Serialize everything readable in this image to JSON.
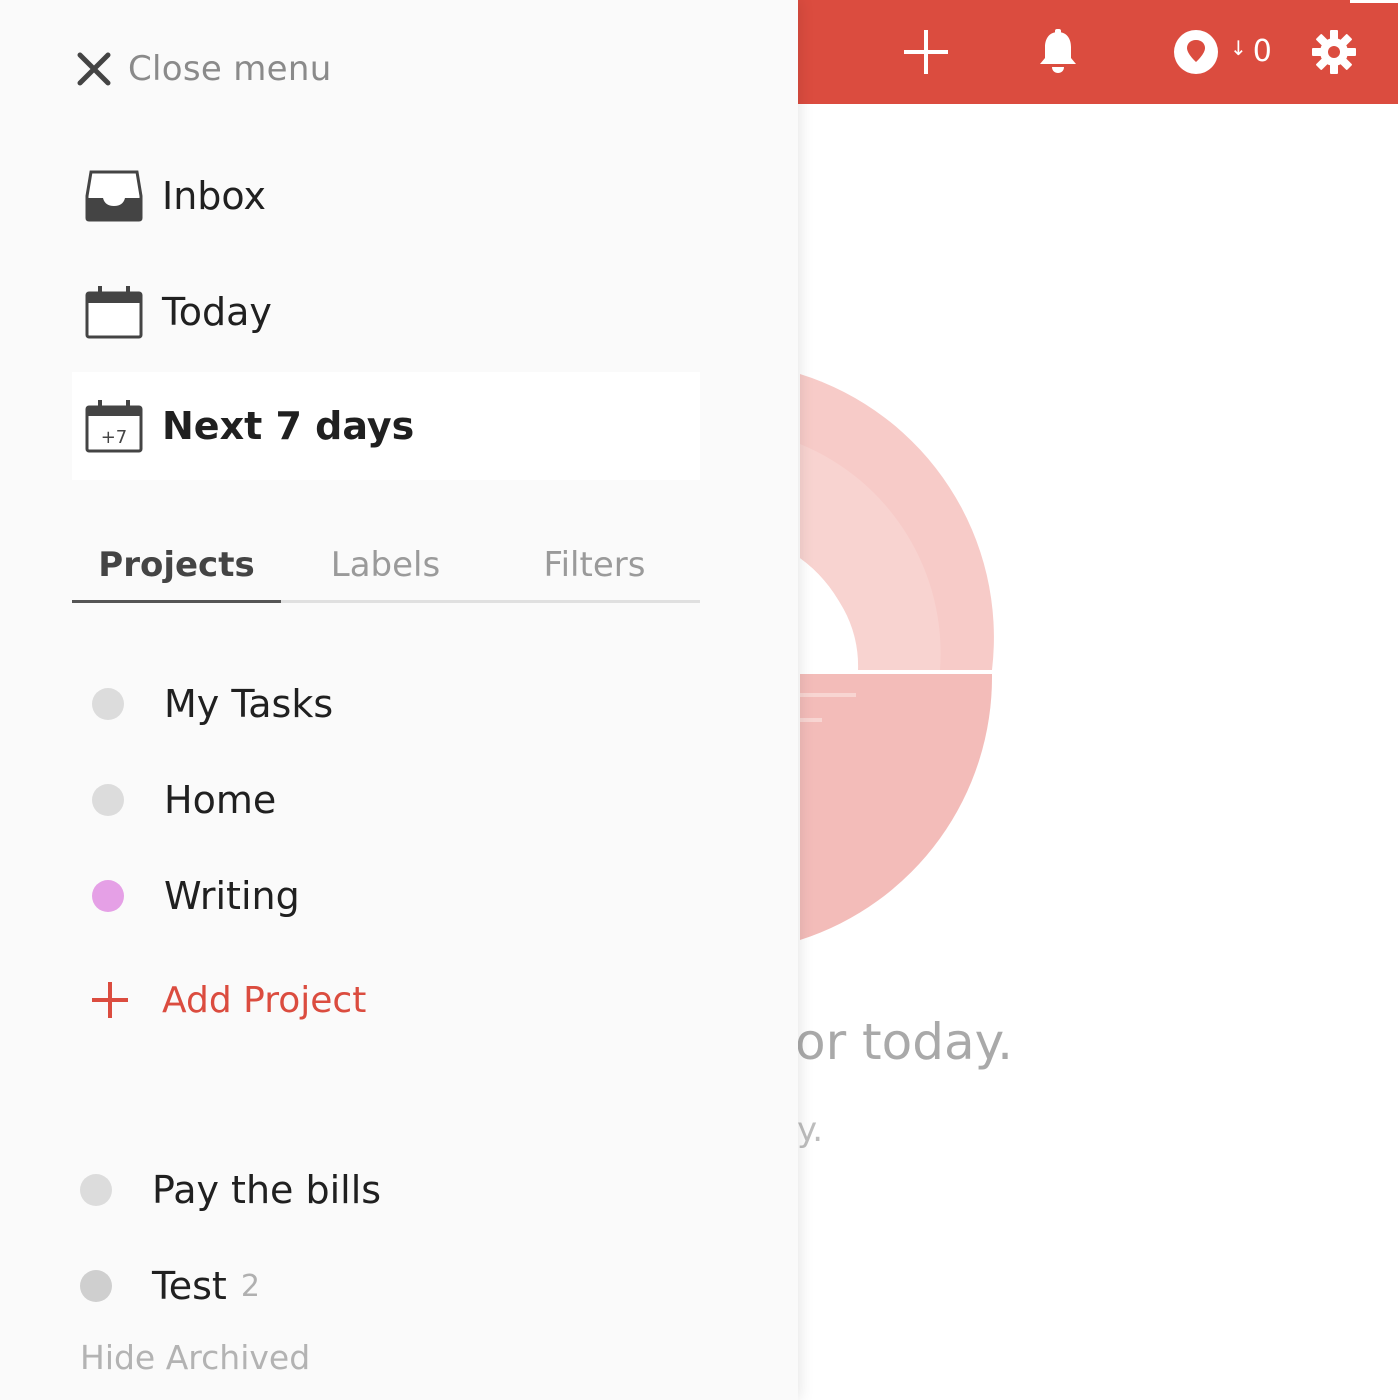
{
  "colors": {
    "brand": "#db4c3f",
    "project_neutral": "#dcdcdc",
    "project_writing": "#e5a0e6"
  },
  "topbar": {
    "icons": [
      "add-icon",
      "bell-icon",
      "karma-icon",
      "settings-icon"
    ],
    "karma_arrow": "↓",
    "karma_count": "0"
  },
  "drawer": {
    "close_label": "Close menu",
    "nav": {
      "inbox": "Inbox",
      "today": "Today",
      "next7": "Next 7 days",
      "next7_badge": "+7"
    },
    "tabs": {
      "projects": "Projects",
      "labels": "Labels",
      "filters": "Filters",
      "active": "Projects"
    },
    "projects": [
      {
        "name": "My Tasks",
        "color": "#dcdcdc"
      },
      {
        "name": "Home",
        "color": "#dcdcdc"
      },
      {
        "name": "Writing",
        "color": "#e5a0e6"
      }
    ],
    "add_project_label": "Add Project",
    "archived_projects": [
      {
        "name": "Pay the bills",
        "count": ""
      },
      {
        "name": "Test",
        "count": "2"
      }
    ],
    "hide_archived_label": "Hide Archived"
  },
  "main": {
    "empty_title": "or today.",
    "empty_subtitle": "y."
  }
}
